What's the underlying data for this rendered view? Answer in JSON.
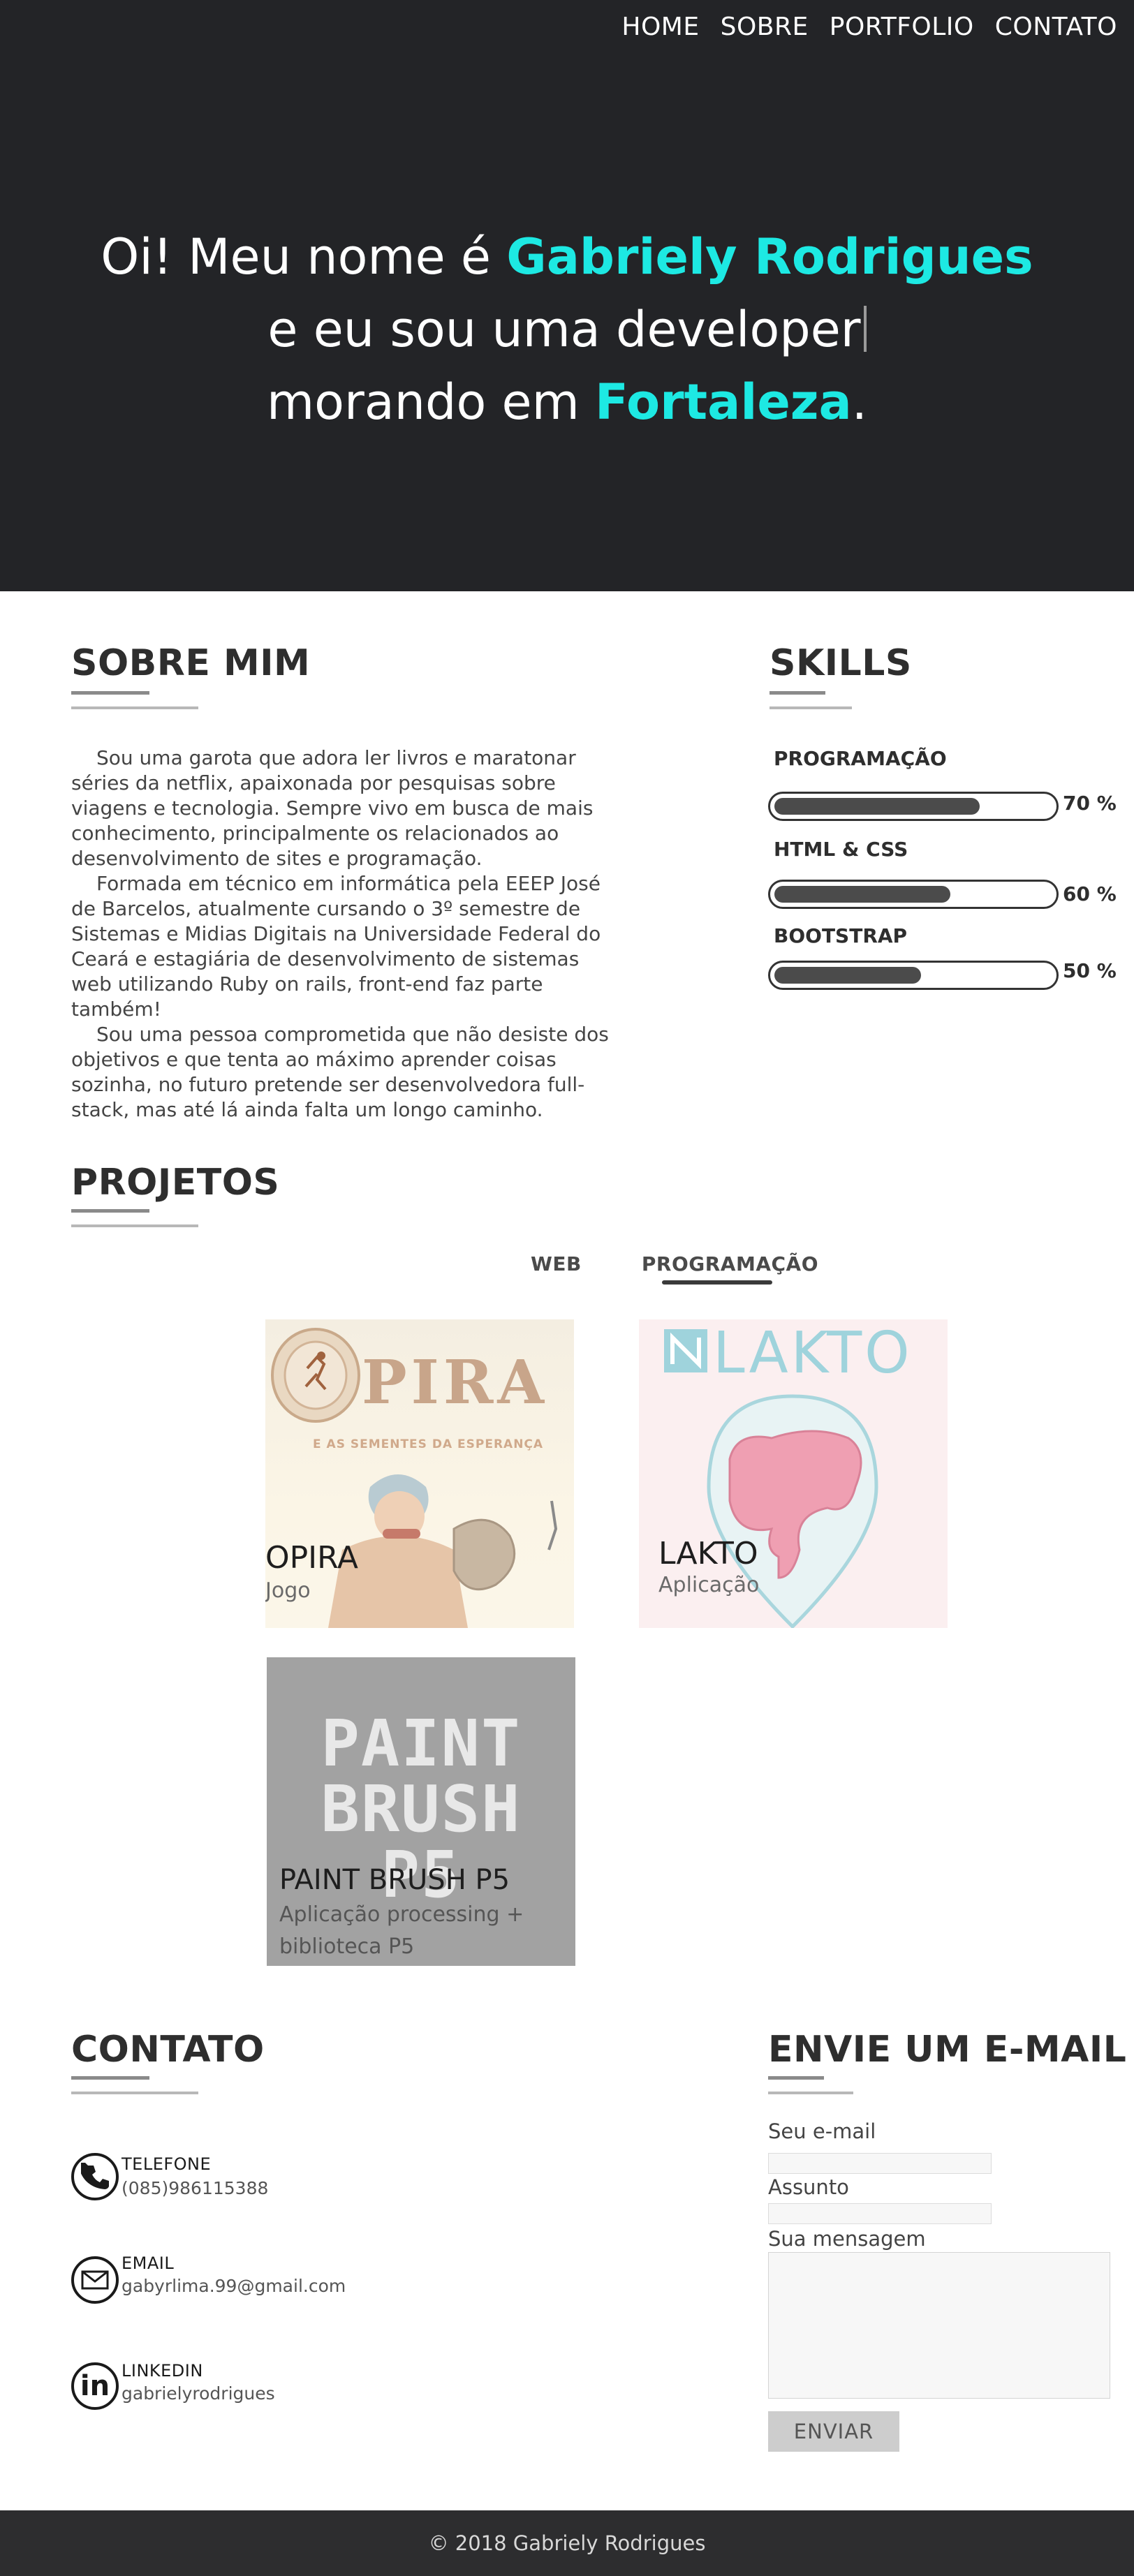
{
  "nav": {
    "items": [
      "HOME",
      "SOBRE",
      "PORTFOLIO",
      "CONTATO"
    ]
  },
  "hero": {
    "line1_prefix": "Oi! Meu nome é ",
    "name": "Gabriely Rodrigues",
    "line2": "e eu sou uma developer",
    "line3_prefix": "morando em ",
    "city": "Fortaleza",
    "line3_suffix": "."
  },
  "about": {
    "title": "SOBRE MIM",
    "paragraphs": [
      "Sou uma garota que adora ler livros e maratonar séries da netflix, apaixonada por pesquisas sobre viagens e tecnologia. Sempre vivo em busca de mais conhecimento, principalmente os relacionados ao desenvolvimento de sites e programação.",
      "Formada em técnico em informática pela EEEP José de Barcelos, atualmente cursando o 3º semestre de Sistemas e Midias Digitais na Universidade Federal do Ceará e estagiária de desenvolvimento de sistemas web utilizando Ruby on rails, front-end faz parte também!",
      "Sou uma pessoa comprometida que não desiste dos objetivos e que tenta ao máximo aprender coisas sozinha, no futuro pretende ser desenvolvedora full-stack, mas até lá ainda falta um longo caminho."
    ]
  },
  "skills": {
    "title": "SKILLS",
    "items": [
      {
        "name": "PROGRAMAÇÃO",
        "level": 0.7,
        "label": "70 %"
      },
      {
        "name": "HTML & CSS",
        "level": 0.6,
        "label": "60 %"
      },
      {
        "name": "BOOTSTRAP",
        "level": 0.5,
        "label": "50 %"
      }
    ]
  },
  "projects": {
    "title": "PROJETOS",
    "tabs": [
      "WEB",
      "PROGRAMAÇÃO"
    ],
    "active_tab": "PROGRAMAÇÃO",
    "cards": [
      {
        "title": "OPIRA",
        "subtitle": "Jogo",
        "art_title": "PIRA",
        "art_subtitle": "E AS SEMENTES DA ESPERANÇA"
      },
      {
        "title": "LAKTO",
        "subtitle": "Aplicação",
        "art_title": "LAKTO"
      },
      {
        "title": "PAINT BRUSH P5",
        "subtitle": "Aplicação processing + biblioteca P5",
        "art_words": [
          "PAINT",
          "BRUSH",
          "P5"
        ]
      }
    ]
  },
  "contact": {
    "title": "CONTATO",
    "items": [
      {
        "label": "TELEFONE",
        "value": "(085)986115388",
        "icon": "phone-icon"
      },
      {
        "label": "EMAIL",
        "value": "gabyrlima.99@gmail.com",
        "icon": "envelope-icon"
      },
      {
        "label": "LINKEDIN",
        "value": "gabrielyrodrigues",
        "icon": "linkedin-icon"
      }
    ]
  },
  "email_form": {
    "title": "ENVIE UM E-MAIL",
    "email_label": "Seu e-mail",
    "subject_label": "Assunto",
    "message_label": "Sua mensagem",
    "send_label": "ENVIAR"
  },
  "footer": {
    "text": "© 2018 Gabriely Rodrigues"
  },
  "colors": {
    "hero_bg": "#232427",
    "accent": "#1de9e3",
    "footer_bg": "#2d2d2f"
  }
}
